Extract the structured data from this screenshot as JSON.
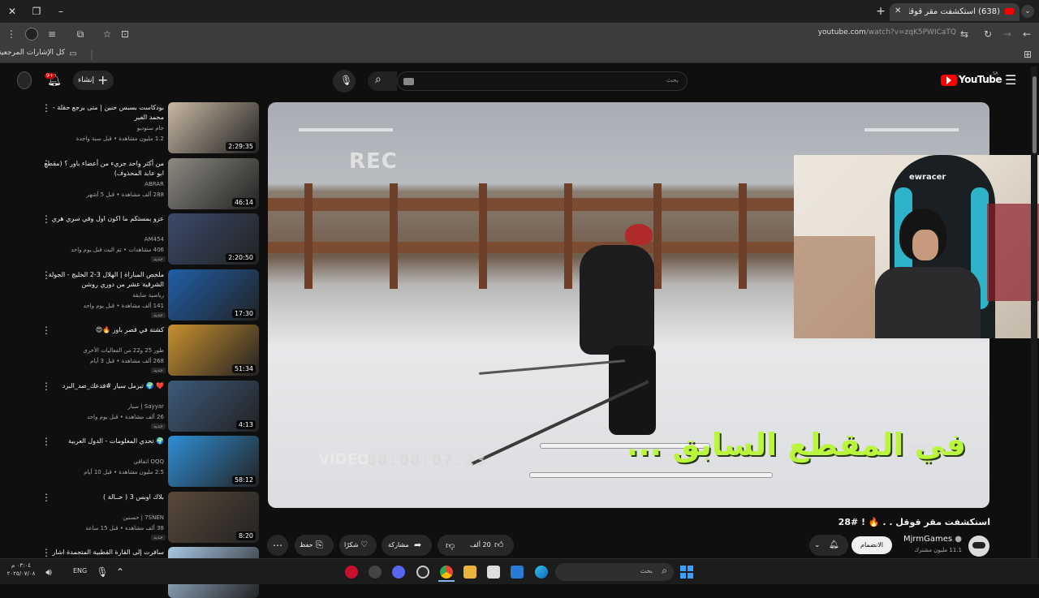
{
  "browser": {
    "tab_title": "(638) استكشفت مقر قوقل . . 🔥 ! #28",
    "tab_count_badge": "",
    "url_domain": "youtube.com",
    "url_path": "/watch?v=zqK5PWICaTQ",
    "bookmarks_label": "كل الإشارات المرجعية"
  },
  "masthead": {
    "logo_text": "YouTube",
    "region": "SA",
    "search_placeholder": "بحث",
    "create_label": "إنشاء",
    "notif_count": "9+"
  },
  "video": {
    "caption": "في المقطع السابق ...",
    "rec_label": "REC",
    "video_label": "VIDEO",
    "timecode": "00:00:07:23",
    "percent": "22%",
    "title": "استكشفت مقر قوقل . . 🔥 ! #28",
    "channel": "MjrmGames",
    "subs": "11.1 مليون مشترك",
    "join_label": "الانضمام",
    "likes": "20 ألف",
    "share_label": "مشاركة",
    "thanks_label": "شكرًا",
    "save_label": "حفظ"
  },
  "sidebar": {
    "items": [
      {
        "title": "بودكاست بسبس حنين | متى يرجع حقلة - محمد الفير",
        "channel": "جام ستوديو",
        "meta": "1.2 مليون مشاهدة • قبل سنة واحدة",
        "duration": "2:29:35",
        "new": "",
        "thumb": "#c9b9a4"
      },
      {
        "title": "من أكثر واحد جريء من أعضاء باور ؟ (مقطع ابو عابد المحذوف)",
        "channel": "ABRAR",
        "meta": "288 ألف مشاهدة • قبل 5 أشهر",
        "duration": "46:14",
        "new": "",
        "thumb": "#8d8a82"
      },
      {
        "title": "عرو بمستكم ما اكون اول وفي سري هري",
        "channel": "AM454",
        "meta": "406 مشاهدات • تم البث قبل يوم واحد",
        "duration": "2:20:50",
        "new": "جديد",
        "thumb": "#3a4a6a"
      },
      {
        "title": "ملخص المباراة | الهلال 3-2 الخليج - الجولة الشرقية عشر من دوري روشن",
        "channel": "رياضية ضايقة",
        "meta": "141 ألف مشاهدة • قبل يوم واحد",
        "duration": "17:30",
        "new": "جديد",
        "thumb": "#1f5fa8"
      },
      {
        "title": "كشتة في قصر باور 🔥😍",
        "channel": "طور 25 و22 من الفعاليات الأخرى",
        "meta": "268 ألف مشاهدة • قبل 3 أيام",
        "duration": "51:34",
        "new": "جديد",
        "thumb": "#c8902f"
      },
      {
        "title": "❤️ 🌍 تيرمل سيار #فدعك_ضد_البرد",
        "channel": "Sayyar | سيار",
        "meta": "26 ألف مشاهدة • قبل يوم واحد",
        "duration": "4:13",
        "new": "جديد",
        "thumb": "#3d5a7a"
      },
      {
        "title": "🌍 تحدي المعلومات - الدول العربية",
        "channel": "OQQ اتفاقي",
        "meta": "2.5 مليون مشاهدة • قبل 10 أيام",
        "duration": "58:12",
        "new": "",
        "thumb": "#2f8fd6"
      },
      {
        "title": "بلاك اوبس 3 ( حــالة )",
        "channel": "7SNEN | حسنين",
        "meta": "38 ألف مشاهدة • قبل 15 ساعة",
        "duration": "8:20",
        "new": "جديد",
        "thumb": "#5a4a3a"
      },
      {
        "title": "سافرت إلى القارة القطبية المتجمدة اشار كثيرًا",
        "channel": "",
        "meta": "",
        "duration": "",
        "new": "",
        "thumb": "#a9c8e6"
      }
    ]
  },
  "taskbar": {
    "search_placeholder": "بحث",
    "lang": "ENG",
    "time": "٠٣:٠٤ م",
    "date": "٢٠٢٥/٠٧/٠٨"
  },
  "colors": {
    "yt_red": "#ff0000",
    "caption_green": "#b9f53a",
    "accent_blue": "#3ea6ff"
  }
}
